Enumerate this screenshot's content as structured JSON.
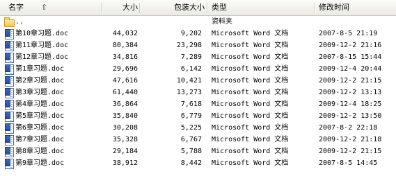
{
  "header": {
    "name": "名字",
    "sort_arrow": "⇧",
    "size": "大小",
    "packed": "包装大小",
    "type": "类型",
    "modified": "修改时间"
  },
  "parent_row": {
    "name": "..",
    "type": "资料夹",
    "icon": "folder-icon"
  },
  "files": [
    {
      "name": "第10章习题.doc",
      "size": "44,032",
      "packed": "9,202",
      "type": "Microsoft Word 文档",
      "modified": "2007-8-5 21:19",
      "icon": "word-doc-icon"
    },
    {
      "name": "第11章习题.doc",
      "size": "80,384",
      "packed": "23,298",
      "type": "Microsoft Word 文档",
      "modified": "2009-12-2 21:16",
      "icon": "word-doc-icon"
    },
    {
      "name": "第12章习题.doc",
      "size": "34,816",
      "packed": "7,289",
      "type": "Microsoft Word 文档",
      "modified": "2007-8-15 15:44",
      "icon": "word-doc-icon"
    },
    {
      "name": "第1章习题.doc",
      "size": "29,696",
      "packed": "6,142",
      "type": "Microsoft Word 文档",
      "modified": "2009-12-4 20:44",
      "icon": "word-doc-icon"
    },
    {
      "name": "第2章习题.doc",
      "size": "47,616",
      "packed": "10,421",
      "type": "Microsoft Word 文档",
      "modified": "2009-12-2 21:15",
      "icon": "word-doc-icon"
    },
    {
      "name": "第3章习题.doc",
      "size": "61,440",
      "packed": "13,273",
      "type": "Microsoft Word 文档",
      "modified": "2009-12-2 13:13",
      "icon": "word-doc-icon"
    },
    {
      "name": "第4章习题.doc",
      "size": "36,864",
      "packed": "7,618",
      "type": "Microsoft Word 文档",
      "modified": "2009-12-4 18:25",
      "icon": "word-doc-icon"
    },
    {
      "name": "第5章习题.doc",
      "size": "35,840",
      "packed": "6,779",
      "type": "Microsoft Word 文档",
      "modified": "2009-12-2 13:50",
      "icon": "word-doc-icon"
    },
    {
      "name": "第6章习题.doc",
      "size": "30,208",
      "packed": "5,225",
      "type": "Microsoft Word 文档",
      "modified": "2007-8-2 22:18",
      "icon": "word-doc-icon"
    },
    {
      "name": "第7章习题.doc",
      "size": "35,328",
      "packed": "6,767",
      "type": "Microsoft Word 文档",
      "modified": "2009-12-2 21:18",
      "icon": "word-doc-icon"
    },
    {
      "name": "第8章习题.doc",
      "size": "29,184",
      "packed": "5,788",
      "type": "Microsoft Word 文档",
      "modified": "2009-12-2 21:15",
      "icon": "word-doc-icon"
    },
    {
      "name": "第9章习题.doc",
      "size": "38,912",
      "packed": "8,442",
      "type": "Microsoft Word 文档",
      "modified": "2007-8-5 14:45",
      "icon": "word-doc-icon"
    }
  ]
}
